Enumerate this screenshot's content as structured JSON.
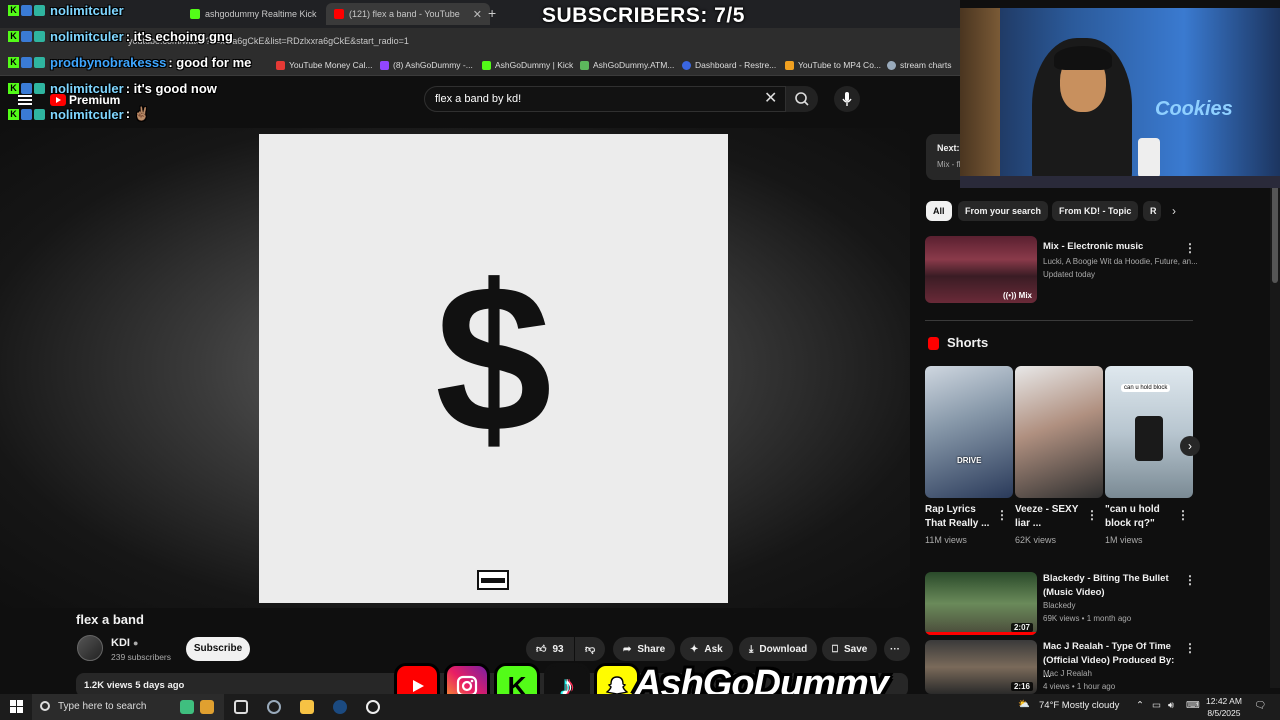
{
  "browser": {
    "tabs": [
      {
        "label": "ashgodummy Realtime Kick",
        "icon": "kick-tab-icon"
      },
      {
        "label": "(121) flex a band - YouTube",
        "icon": "youtube-tab-icon"
      }
    ],
    "url": "youtube.com/watch?v=xxra6gCkE&list=RDzlxxra6gCkE&start_radio=1",
    "bookmarks": [
      "YouTube Money Cal...",
      "(8) AshGoDummy -...",
      "AshGoDummy | Kick",
      "AshGoDummy.ATM...",
      "Dashboard - Restre...",
      "YouTube to MP4 Co...",
      "stream charts"
    ]
  },
  "overlay": {
    "subscribers_label": "SUBSCRIBERS: 7/5",
    "brand": "AshGoDummy"
  },
  "chat": [
    {
      "user": "nolimitculer",
      "msg": "",
      "color": "#7fd6ff"
    },
    {
      "user": "nolimitculer",
      "msg": " : it's echoing gng",
      "color": "#7fd6ff"
    },
    {
      "user": "prodbynobrakesss",
      "msg": " : good for me",
      "color": "#3ea6ff"
    },
    {
      "user": "nolimitculer",
      "msg": " : it's good now",
      "color": "#7fd6ff"
    },
    {
      "user": "nolimitculer",
      "msg": " : ✌🏽",
      "color": "#7fd6ff"
    }
  ],
  "youtube": {
    "logo_text": "Premium",
    "search_value": "flex a band by kd!",
    "video": {
      "title": "flex a band",
      "channel": "KDI",
      "subscribers": "239 subscribers",
      "subscribe_label": "Subscribe",
      "likes": "93",
      "share_label": "Share",
      "ask_label": "Ask",
      "download_label": "Download",
      "save_label": "Save",
      "stats": "1.2K views  5 days ago"
    },
    "up_next": {
      "label": "Next:",
      "sub": "Mix - fl"
    },
    "chips": [
      "All",
      "From your search",
      "From KD! - Topic",
      "R"
    ],
    "mix": {
      "title": "Mix - Electronic music",
      "artists": "Lucki, A Boogie Wit da Hoodie, Future, an...",
      "updated": "Updated today",
      "badge": "Mix"
    },
    "shorts_heading": "Shorts",
    "shorts": [
      {
        "title": "Rap Lyrics That Really ...",
        "views": "11M views",
        "overlay": "DRIVE"
      },
      {
        "title": "Veeze - SEXY liar ...",
        "views": "62K views",
        "overlay": ""
      },
      {
        "title": "\"can u hold block rq?\"",
        "views": "1M views",
        "overlay": "can u hold block"
      }
    ],
    "recommendations": [
      {
        "title": "Blackedy - Biting The Bullet (Music Video)",
        "channel": "Blackedy",
        "meta": "69K views • 1 month ago",
        "duration": "2:07"
      },
      {
        "title": "Mac J Realah - Type Of Time (Official Video) Produced By: ...",
        "channel": "Mac J Realah",
        "meta": "4 views • 1 hour ago",
        "duration": "2:16"
      }
    ]
  },
  "taskbar": {
    "search_placeholder": "Type here to search",
    "weather": "74°F  Mostly cloudy",
    "time": "12:42 AM",
    "date": "8/5/2025"
  },
  "colors": {
    "youtube_red": "#ff0000",
    "kick_green": "#53fc18",
    "background": "#0f0f0f"
  }
}
